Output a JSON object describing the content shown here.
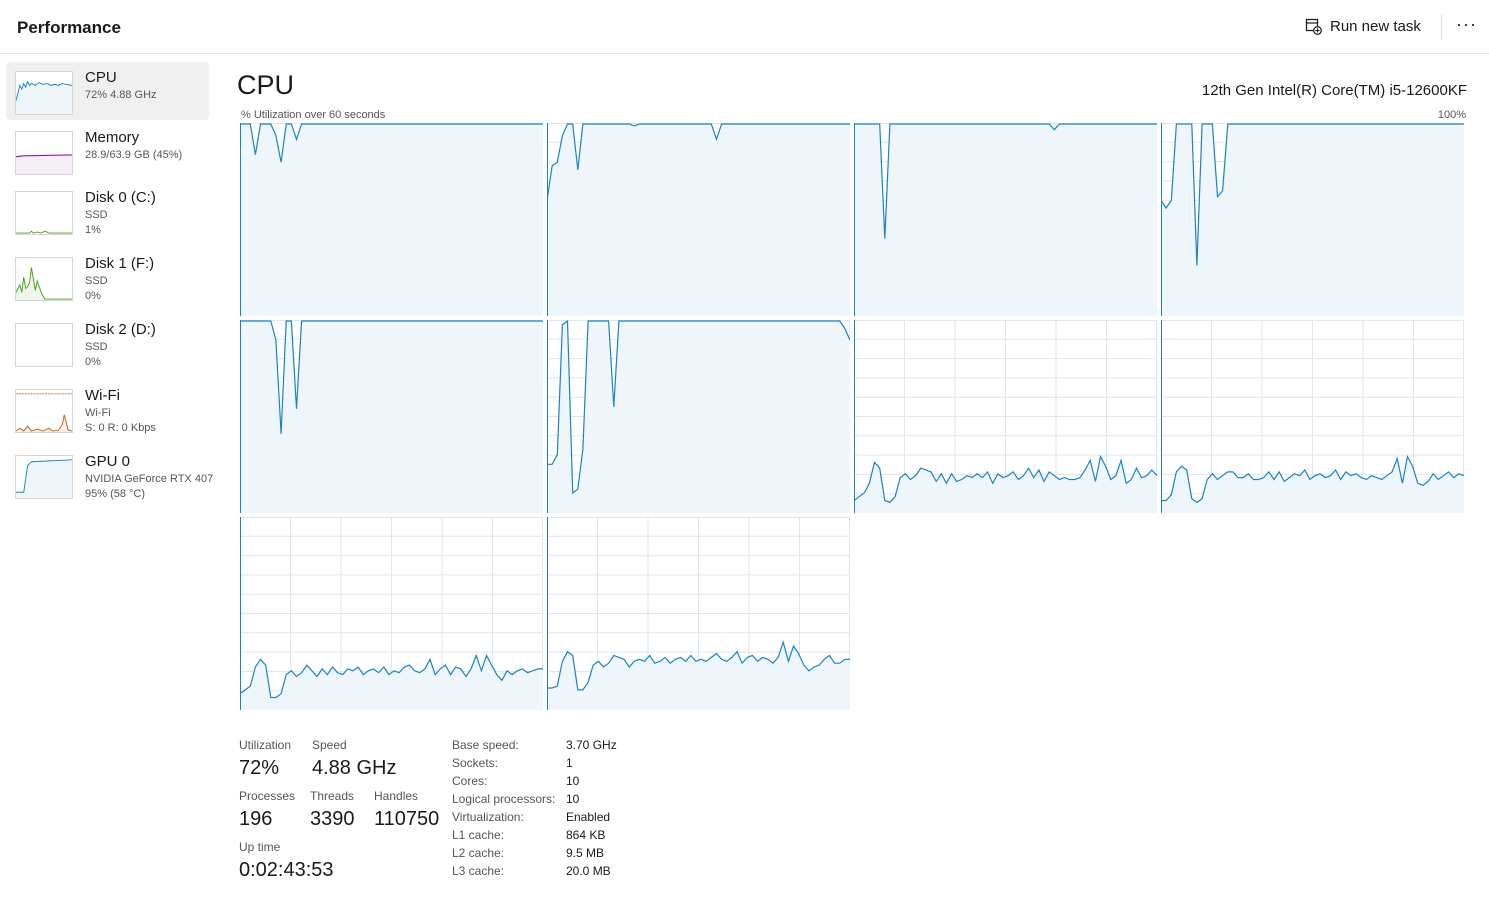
{
  "header": {
    "title": "Performance",
    "run_new_task": "Run new task",
    "more": "···"
  },
  "sidebar": {
    "items": [
      {
        "name": "CPU",
        "line1": "72%  4.88 GHz",
        "line2": "",
        "color": "#1a83c2",
        "fill": "#eef5fb"
      },
      {
        "name": "Memory",
        "line1": "28.9/63.9 GB (45%)",
        "line2": "",
        "color": "#8b1e98",
        "fill": "#f5eef7"
      },
      {
        "name": "Disk 0 (C:)",
        "line1": "SSD",
        "line2": "1%",
        "color": "#4aa31f",
        "fill": "#eef7ea"
      },
      {
        "name": "Disk 1 (F:)",
        "line1": "SSD",
        "line2": "0%",
        "color": "#4aa31f",
        "fill": "#eef7ea"
      },
      {
        "name": "Disk 2 (D:)",
        "line1": "SSD",
        "line2": "0%",
        "color": "#4aa31f",
        "fill": "#eef7ea"
      },
      {
        "name": "Wi-Fi",
        "line1": "Wi-Fi",
        "line2": "S: 0  R: 0 Kbps",
        "color": "#b9652a",
        "fill": "#f8efe8"
      },
      {
        "name": "GPU 0",
        "line1": "NVIDIA GeForce RTX 407",
        "line2": "95%  (58 °C)",
        "color": "#1a83c2",
        "fill": "#eef5fb"
      }
    ]
  },
  "main": {
    "title": "CPU",
    "model": "12th Gen Intel(R) Core(TM) i5-12600KF",
    "graph_caption": "% Utilization over 60 seconds",
    "graph_max": "100%",
    "line_color": "#1a83c2",
    "fill_color": "#eef5fb",
    "grid_color": "#dce6ef"
  },
  "stats": {
    "utilization_label": "Utilization",
    "utilization": "72%",
    "speed_label": "Speed",
    "speed": "4.88 GHz",
    "processes_label": "Processes",
    "processes": "196",
    "threads_label": "Threads",
    "threads": "3390",
    "handles_label": "Handles",
    "handles": "110750",
    "uptime_label": "Up time",
    "uptime": "0:02:43:53"
  },
  "specs": [
    {
      "label": "Base speed:",
      "value": "3.70 GHz"
    },
    {
      "label": "Sockets:",
      "value": "1"
    },
    {
      "label": "Cores:",
      "value": "10"
    },
    {
      "label": "Logical processors:",
      "value": "10"
    },
    {
      "label": "Virtualization:",
      "value": "Enabled"
    },
    {
      "label": "L1 cache:",
      "value": "864 KB"
    },
    {
      "label": "L2 cache:",
      "value": "9.5 MB"
    },
    {
      "label": "L3 cache:",
      "value": "20.0 MB"
    }
  ],
  "chart_data": {
    "type": "line",
    "title": "% Utilization over 60 seconds",
    "ylim": [
      0,
      100
    ],
    "x_count": 60,
    "series": [
      {
        "values": [
          100,
          100,
          100,
          84,
          100,
          100,
          100,
          94,
          80,
          100,
          100,
          92,
          100,
          100,
          100,
          100,
          100,
          100,
          100,
          100,
          100,
          100,
          100,
          100,
          100,
          100,
          100,
          100,
          100,
          100,
          100,
          100,
          100,
          100,
          100,
          100,
          100,
          100,
          100,
          100,
          100,
          100,
          100,
          100,
          100,
          100,
          100,
          100,
          100,
          100,
          100,
          100,
          100,
          100,
          100,
          100,
          100,
          100,
          100,
          100
        ]
      },
      {
        "values": [
          60,
          78,
          80,
          94,
          100,
          100,
          76,
          100,
          100,
          100,
          100,
          100,
          100,
          100,
          100,
          100,
          100,
          99,
          100,
          100,
          100,
          100,
          100,
          100,
          100,
          100,
          100,
          100,
          100,
          100,
          100,
          100,
          100,
          92,
          100,
          100,
          100,
          100,
          100,
          100,
          100,
          100,
          100,
          100,
          100,
          100,
          100,
          100,
          100,
          100,
          100,
          100,
          100,
          100,
          100,
          100,
          100,
          100,
          100,
          100
        ]
      },
      {
        "values": [
          100,
          100,
          100,
          100,
          100,
          100,
          40,
          100,
          100,
          100,
          100,
          100,
          100,
          100,
          100,
          100,
          100,
          100,
          100,
          100,
          100,
          100,
          100,
          100,
          100,
          100,
          100,
          100,
          100,
          100,
          100,
          100,
          100,
          100,
          100,
          100,
          100,
          100,
          100,
          97,
          100,
          100,
          100,
          100,
          100,
          100,
          100,
          100,
          100,
          100,
          100,
          100,
          100,
          100,
          100,
          100,
          100,
          100,
          100,
          100
        ]
      },
      {
        "values": [
          60,
          56,
          60,
          100,
          100,
          100,
          100,
          26,
          100,
          100,
          100,
          62,
          65,
          100,
          100,
          100,
          100,
          100,
          100,
          100,
          100,
          100,
          100,
          100,
          100,
          100,
          100,
          100,
          100,
          100,
          100,
          100,
          100,
          100,
          100,
          100,
          100,
          100,
          100,
          100,
          100,
          100,
          100,
          100,
          100,
          100,
          100,
          100,
          100,
          100,
          100,
          100,
          100,
          100,
          100,
          100,
          100,
          100,
          100,
          100
        ]
      },
      {
        "values": [
          100,
          100,
          100,
          100,
          100,
          100,
          100,
          90,
          41,
          100,
          100,
          54,
          100,
          100,
          100,
          100,
          100,
          100,
          100,
          100,
          100,
          100,
          100,
          100,
          100,
          100,
          100,
          100,
          100,
          100,
          100,
          100,
          100,
          100,
          100,
          100,
          100,
          100,
          100,
          100,
          100,
          100,
          100,
          100,
          100,
          100,
          100,
          100,
          100,
          100,
          100,
          100,
          100,
          100,
          100,
          100,
          100,
          100,
          100,
          100
        ]
      },
      {
        "values": [
          25,
          25,
          30,
          98,
          100,
          10,
          12,
          33,
          100,
          100,
          100,
          100,
          100,
          55,
          100,
          100,
          100,
          100,
          100,
          100,
          100,
          100,
          100,
          100,
          100,
          100,
          100,
          100,
          100,
          100,
          100,
          100,
          100,
          100,
          100,
          100,
          100,
          100,
          100,
          100,
          100,
          100,
          100,
          100,
          100,
          100,
          100,
          100,
          100,
          100,
          100,
          100,
          100,
          100,
          100,
          100,
          100,
          100,
          96,
          90
        ]
      },
      {
        "values": [
          6,
          8,
          10,
          15,
          26,
          23,
          6,
          5,
          8,
          18,
          20,
          17,
          19,
          23,
          22,
          21,
          16,
          20,
          15,
          20,
          16,
          17,
          19,
          18,
          20,
          18,
          21,
          15,
          20,
          18,
          19,
          21,
          17,
          19,
          23,
          18,
          22,
          16,
          21,
          19,
          17,
          18,
          17,
          17,
          18,
          22,
          27,
          16,
          29,
          24,
          17,
          19,
          27,
          15,
          17,
          23,
          18,
          19,
          22,
          19
        ]
      },
      {
        "values": [
          6,
          6,
          9,
          21,
          24,
          22,
          7,
          5,
          7,
          17,
          20,
          17,
          19,
          21,
          21,
          18,
          18,
          20,
          17,
          17,
          18,
          21,
          17,
          21,
          16,
          18,
          20,
          19,
          22,
          17,
          19,
          20,
          18,
          19,
          22,
          17,
          21,
          19,
          20,
          18,
          17,
          19,
          18,
          17,
          19,
          21,
          28,
          15,
          29,
          24,
          15,
          14,
          16,
          20,
          17,
          19,
          21,
          18,
          20,
          19
        ]
      },
      {
        "values": [
          8,
          10,
          12,
          22,
          26,
          23,
          6,
          6,
          8,
          18,
          20,
          17,
          19,
          23,
          20,
          17,
          21,
          18,
          22,
          19,
          18,
          21,
          20,
          22,
          18,
          20,
          21,
          19,
          22,
          18,
          20,
          19,
          22,
          23,
          20,
          19,
          21,
          26,
          18,
          21,
          23,
          18,
          22,
          21,
          17,
          21,
          28,
          20,
          28,
          23,
          18,
          15,
          20,
          18,
          20,
          21,
          19,
          20,
          21,
          21
        ]
      },
      {
        "values": [
          11,
          11,
          12,
          25,
          30,
          28,
          10,
          10,
          14,
          23,
          25,
          22,
          24,
          28,
          27,
          26,
          22,
          25,
          26,
          25,
          28,
          24,
          25,
          27,
          24,
          26,
          27,
          25,
          28,
          25,
          26,
          25,
          27,
          29,
          26,
          25,
          27,
          30,
          24,
          27,
          28,
          25,
          27,
          26,
          24,
          27,
          35,
          25,
          33,
          29,
          23,
          20,
          22,
          23,
          26,
          28,
          24,
          24,
          26,
          26
        ]
      }
    ]
  }
}
